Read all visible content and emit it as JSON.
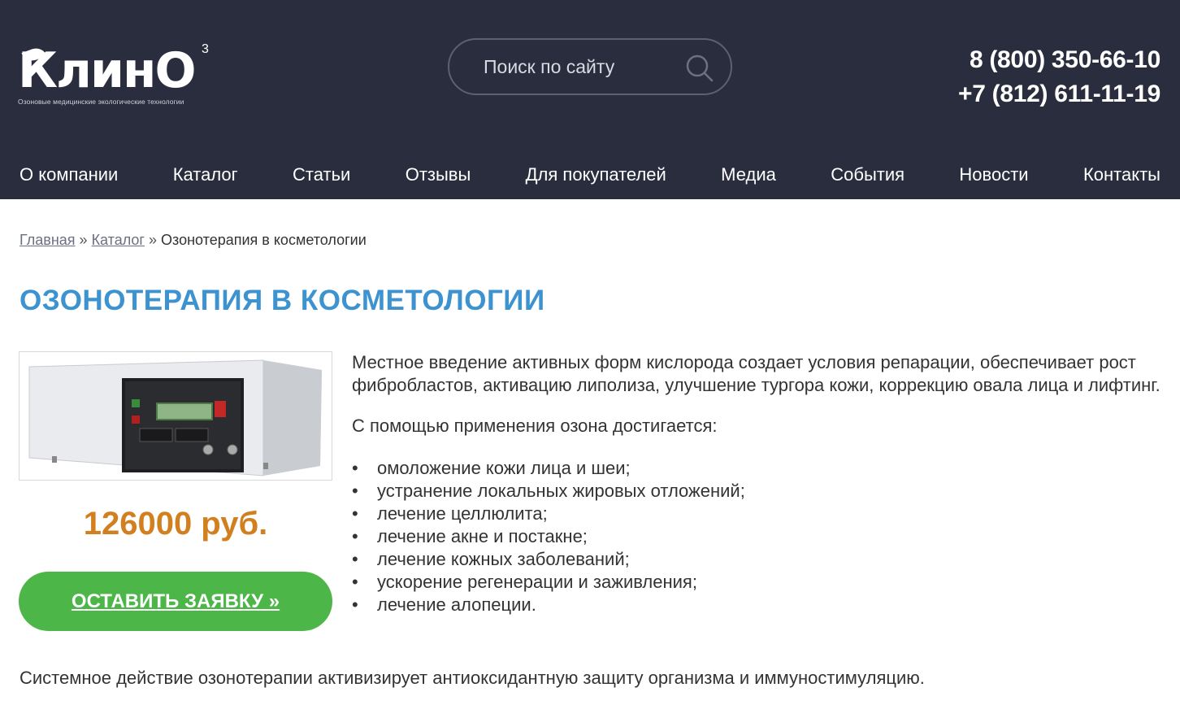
{
  "header": {
    "logo_text": "КлинО",
    "logo_sup": "3",
    "logo_tagline": "Озоновые медицинские экологические технологии",
    "search_placeholder": "Поиск по сайту",
    "phones": [
      "8 (800) 350-66-10",
      "+7 (812) 611-11-19"
    ]
  },
  "nav": {
    "items": [
      {
        "label": "О компании",
        "active": false
      },
      {
        "label": "Каталог",
        "active": true
      },
      {
        "label": "Статьи",
        "active": false
      },
      {
        "label": "Отзывы",
        "active": false
      },
      {
        "label": "Для покупателей",
        "active": false
      },
      {
        "label": "Медиа",
        "active": false
      },
      {
        "label": "События",
        "active": false
      },
      {
        "label": "Новости",
        "active": false
      },
      {
        "label": "Контакты",
        "active": false
      }
    ]
  },
  "breadcrumb": {
    "home": "Главная",
    "catalog": "Каталог",
    "separator": "»",
    "current": "Озонотерапия в косметологии"
  },
  "page": {
    "title": "ОЗОНОТЕРАПИЯ В КОСМЕТОЛОГИИ",
    "price": "126000 руб.",
    "order_button": "ОСТАВИТЬ ЗАЯВКУ »",
    "intro": "Местное введение активных форм кислорода создает условия репарации, обеспечивает рост фибробластов, активацию липолиза, улучшение тургора кожи, коррекцию овала лица и лифтинг.",
    "subheading": "С помощью применения озона достигается:",
    "benefits": [
      "омоложение кожи лица и шеи;",
      "устранение локальных жировых отложений;",
      "лечение целлюлита;",
      "лечение акне и постакне;",
      "лечение кожных заболеваний;",
      "ускорение регенерации и заживления;",
      "лечение алопеции."
    ],
    "bottom_text": "Системное действие озонотерапии активизирует антиоксидантную защиту организма и иммуностимуляцию."
  },
  "colors": {
    "header_bg": "#2a2d3d",
    "title_blue": "#3d92d0",
    "price_orange": "#d2801f",
    "button_green": "#4cb649"
  }
}
